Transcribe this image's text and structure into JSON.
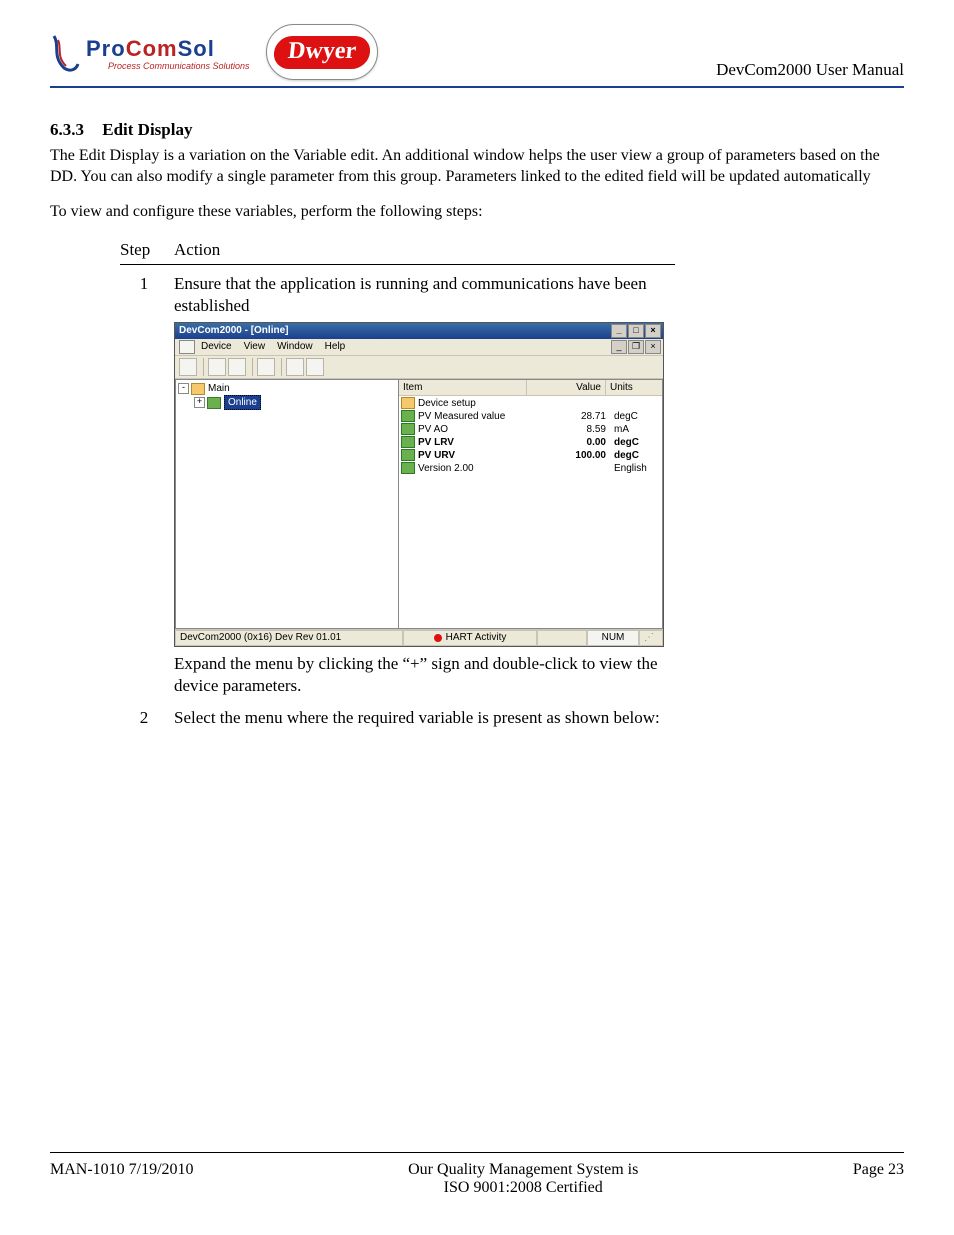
{
  "header": {
    "logo1_main_pro": "Pro",
    "logo1_main_com": "Com",
    "logo1_main_sol": "Sol",
    "logo1_sub": "Process Communications Solutions",
    "logo2": "Dwyer",
    "doc_title": "DevCom2000 User Manual"
  },
  "section": {
    "number": "6.3.3",
    "title": "Edit Display"
  },
  "paragraphs": {
    "p1": "The Edit Display is a variation on the Variable edit.  An additional window helps the user view a group of parameters based on the DD. You can also modify a single parameter from this group.  Parameters linked to the edited field will be updated automatically",
    "p2": "To view and configure these variables, perform the following steps:"
  },
  "table": {
    "h_step": "Step",
    "h_action": "Action",
    "step1_num": "1",
    "step1_action": "Ensure that the application is running and communications have been established",
    "step1_post": "Expand the menu by clicking the “+” sign and double-click to view the device parameters.",
    "step2_num": "2",
    "step2_action": "Select the menu where the required variable is present as shown below:"
  },
  "app": {
    "title": "DevCom2000 - [Online]",
    "menu": {
      "device": "Device",
      "view": "View",
      "window": "Window",
      "help": "Help"
    },
    "tree": {
      "root": "Main",
      "online": "Online"
    },
    "list": {
      "col_item": "Item",
      "col_value": "Value",
      "col_units": "Units",
      "rows": [
        {
          "item": "Device setup",
          "value": "",
          "units": "",
          "folder": true,
          "bold": false
        },
        {
          "item": "PV Measured value",
          "value": "28.71",
          "units": "degC",
          "folder": false,
          "bold": false
        },
        {
          "item": "PV AO",
          "value": "8.59",
          "units": "mA",
          "folder": false,
          "bold": false
        },
        {
          "item": "PV LRV",
          "value": "0.00",
          "units": "degC",
          "folder": false,
          "bold": true
        },
        {
          "item": "PV URV",
          "value": "100.00",
          "units": "degC",
          "folder": false,
          "bold": true
        },
        {
          "item": "Version 2.00",
          "value": "",
          "units": "English",
          "folder": false,
          "bold": false
        }
      ]
    },
    "status": {
      "left": "DevCom2000  (0x16) Dev Rev 01.01",
      "mid": "HART Activity",
      "num": "NUM"
    }
  },
  "footer": {
    "left": "MAN-1010 7/19/2010",
    "center1": "Our Quality Management System is",
    "center2": "ISO 9001:2008 Certified",
    "right": "Page 23"
  }
}
